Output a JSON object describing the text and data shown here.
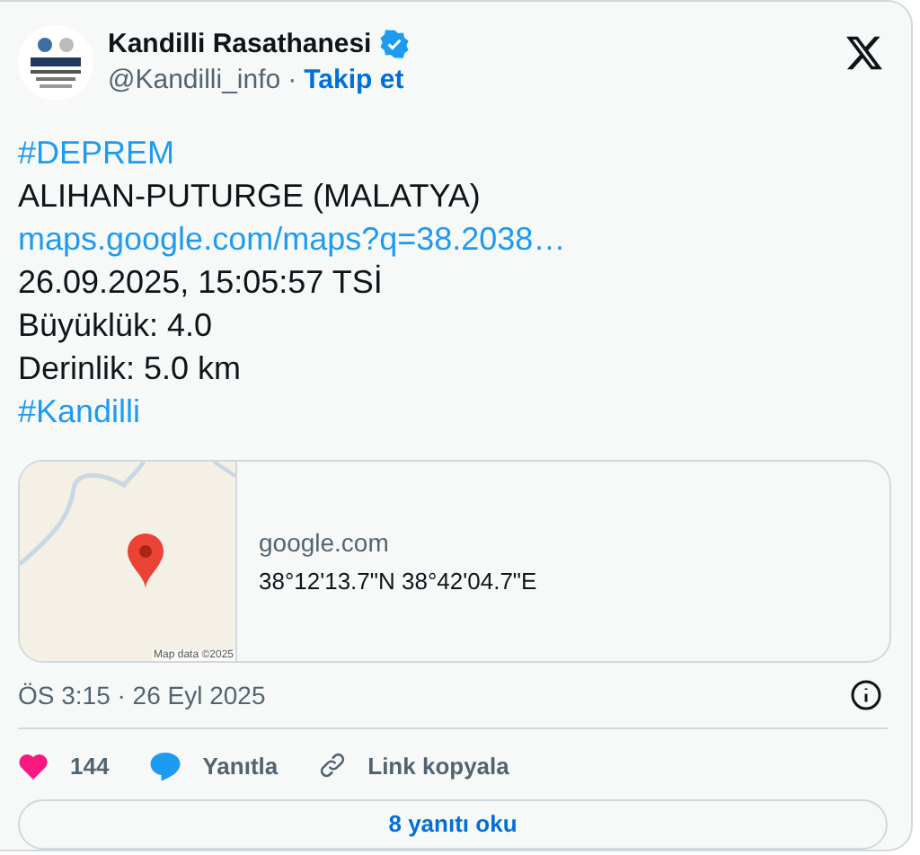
{
  "author": {
    "name": "Kandilli Rasathanesi",
    "verified": true,
    "handle": "@Kandilli_info",
    "separator": "·",
    "follow": "Takip et"
  },
  "lines": [
    {
      "kind": "hashtag",
      "text": "#DEPREM"
    },
    {
      "kind": "text_link",
      "text": "ALIHAN-PUTURGE (MALATYA)",
      "link": "maps.google.com/maps?q=38.2038…"
    },
    {
      "kind": "text",
      "text": "26.09.2025, 15:05:57 TSİ"
    },
    {
      "kind": "text",
      "text": "Büyüklük: 4.0"
    },
    {
      "kind": "text",
      "text": "Derinlik: 5.0 km"
    },
    {
      "kind": "hashtag",
      "text": "#Kandilli"
    }
  ],
  "link_card": {
    "map_credit": "Map data ©2025",
    "domain": "google.com",
    "title": "38°12'13.7\"N 38°42'04.7\"E"
  },
  "timestamp": "ÖS 3:15 · 26 Eyl 2025",
  "actions": [
    {
      "kind": "like",
      "label": "144"
    },
    {
      "kind": "reply",
      "label": "Yanıtla"
    },
    {
      "kind": "copy",
      "label": "Link kopyala"
    }
  ],
  "read_replies": "8 yanıtı oku"
}
